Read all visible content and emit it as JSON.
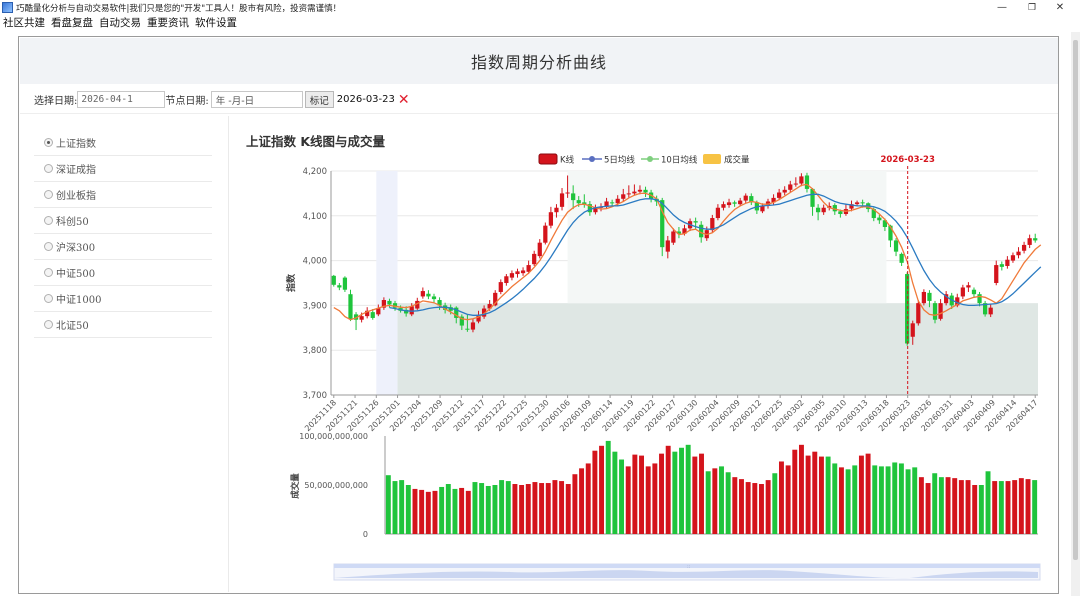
{
  "window": {
    "title": "巧酷量化分析与自动交易软件|我们只是您的\"开发\"工具人！股市有风险，投资需谨慎！",
    "controls": [
      "—",
      "❐",
      "✕"
    ]
  },
  "menu": [
    "社区共建",
    "看盘复盘",
    "自动交易",
    "重要资讯",
    "软件设置"
  ],
  "page_title": "指数周期分析曲线",
  "toolbar": {
    "select_date_label": "选择日期:",
    "select_date_value": "2026-04-1",
    "node_date_label": "节点日期:",
    "node_date_placeholder": "年 -月-日",
    "mark_button": "标记",
    "marked_date": "2026-03-23",
    "close_icon": "✕"
  },
  "sidebar": {
    "items": [
      {
        "label": "上证指数",
        "selected": true
      },
      {
        "label": "深证成指",
        "selected": false
      },
      {
        "label": "创业板指",
        "selected": false
      },
      {
        "label": "科创50",
        "selected": false
      },
      {
        "label": "沪深300",
        "selected": false
      },
      {
        "label": "中证500",
        "selected": false
      },
      {
        "label": "中证1000",
        "selected": false
      },
      {
        "label": "北证50",
        "selected": false
      }
    ]
  },
  "chart_data": {
    "type": "candlestick",
    "title": "上证指数 K线图与成交量",
    "legend": [
      "K线",
      "5日均线",
      "10日均线",
      "成交量"
    ],
    "legend_position": "top-center",
    "colors": {
      "up": "#d4141c",
      "down": "#1fc43c",
      "ma5": "#f07a3a",
      "ma10": "#2b7bc2",
      "volume": "#f7c344",
      "area": "#dfe7e4",
      "band": "#eef1fb",
      "marker": "#d4141c"
    },
    "price_axis": {
      "label": "指数",
      "min": 3700,
      "max": 4200,
      "ticks": [
        "3,700",
        "3,800",
        "3,900",
        "4,000",
        "4,100",
        "4,200"
      ]
    },
    "volume_axis": {
      "label": "成交量",
      "min": 0,
      "max": 100000000000,
      "ticks": [
        "0",
        "50,000,000,000",
        "100,000,000,000"
      ]
    },
    "marker": {
      "date": "20260323",
      "label": "2026-03-23"
    },
    "shaded_periods": [
      {
        "start": "20251126",
        "end": "20251201",
        "level": 3800
      },
      {
        "start": "20251201",
        "end": "20260417",
        "level": 3905
      }
    ],
    "x_labels": [
      "20251118",
      "20251121",
      "20251126",
      "20251201",
      "20251204",
      "20251209",
      "20251212",
      "20251217",
      "20251222",
      "20251225",
      "20251230",
      "20260106",
      "20260109",
      "20260114",
      "20260119",
      "20260122",
      "20260127",
      "20260130",
      "20260204",
      "20260209",
      "20260212",
      "20260225",
      "20260302",
      "20260305",
      "20260310",
      "20260313",
      "20260318",
      "20260323",
      "20260326",
      "20260331",
      "20260403",
      "20260409",
      "20260414",
      "20260417"
    ],
    "candles": [
      [
        3966,
        3946,
        3968,
        3942
      ],
      [
        3945,
        3940,
        3950,
        3934
      ],
      [
        3962,
        3935,
        3965,
        3930
      ],
      [
        3925,
        3870,
        3935,
        3865
      ],
      [
        3880,
        3868,
        3885,
        3845
      ],
      [
        3868,
        3876,
        3884,
        3862
      ],
      [
        3876,
        3888,
        3896,
        3871
      ],
      [
        3885,
        3872,
        3892,
        3868
      ],
      [
        3880,
        3894,
        3902,
        3876
      ],
      [
        3895,
        3912,
        3918,
        3890
      ],
      [
        3910,
        3902,
        3915,
        3895
      ],
      [
        3905,
        3895,
        3910,
        3888
      ],
      [
        3894,
        3888,
        3900,
        3884
      ],
      [
        3890,
        3882,
        3898,
        3875
      ],
      [
        3880,
        3898,
        3905,
        3876
      ],
      [
        3893,
        3910,
        3917,
        3890
      ],
      [
        3920,
        3932,
        3940,
        3915
      ],
      [
        3926,
        3920,
        3934,
        3914
      ],
      [
        3920,
        3914,
        3926,
        3905
      ],
      [
        3912,
        3900,
        3918,
        3890
      ],
      [
        3900,
        3890,
        3906,
        3882
      ],
      [
        3896,
        3888,
        3902,
        3880
      ],
      [
        3895,
        3872,
        3898,
        3860
      ],
      [
        3875,
        3855,
        3880,
        3845
      ],
      [
        3848,
        3846,
        3880,
        3841
      ],
      [
        3846,
        3862,
        3870,
        3840
      ],
      [
        3864,
        3879,
        3888,
        3860
      ],
      [
        3875,
        3893,
        3900,
        3870
      ],
      [
        3893,
        3903,
        3912,
        3888
      ],
      [
        3900,
        3928,
        3934,
        3898
      ],
      [
        3930,
        3952,
        3958,
        3925
      ],
      [
        3950,
        3965,
        3970,
        3944
      ],
      [
        3962,
        3972,
        3978,
        3956
      ],
      [
        3970,
        3976,
        3982,
        3962
      ],
      [
        3972,
        3978,
        3985,
        3966
      ],
      [
        3975,
        3990,
        4000,
        3970
      ],
      [
        3992,
        4015,
        4022,
        3988
      ],
      [
        4010,
        4040,
        4048,
        4005
      ],
      [
        4040,
        4078,
        4085,
        4036
      ],
      [
        4078,
        4108,
        4120,
        4072
      ],
      [
        4108,
        4118,
        4126,
        4096
      ],
      [
        4120,
        4150,
        4162,
        4112
      ],
      [
        4150,
        4152,
        4190,
        4140
      ],
      [
        4150,
        4135,
        4168,
        4115
      ],
      [
        4135,
        4128,
        4144,
        4120
      ],
      [
        4130,
        4126,
        4148,
        4118
      ],
      [
        4126,
        4108,
        4133,
        4100
      ],
      [
        4108,
        4118,
        4125,
        4103
      ],
      [
        4118,
        4120,
        4128,
        4110
      ],
      [
        4120,
        4132,
        4140,
        4116
      ],
      [
        4130,
        4128,
        4136,
        4120
      ],
      [
        4128,
        4138,
        4146,
        4122
      ],
      [
        4138,
        4148,
        4160,
        4132
      ],
      [
        4148,
        4150,
        4168,
        4140
      ],
      [
        4150,
        4154,
        4170,
        4145
      ],
      [
        4154,
        4158,
        4168,
        4148
      ],
      [
        4158,
        4152,
        4165,
        4142
      ],
      [
        4152,
        4138,
        4158,
        4130
      ],
      [
        4138,
        4132,
        4145,
        4122
      ],
      [
        4135,
        4030,
        4140,
        4010
      ],
      [
        4020,
        4045,
        4055,
        4005
      ],
      [
        4040,
        4065,
        4072,
        4035
      ],
      [
        4065,
        4060,
        4075,
        4050
      ],
      [
        4060,
        4072,
        4080,
        4056
      ],
      [
        4072,
        4088,
        4094,
        4066
      ],
      [
        4088,
        4085,
        4096,
        4070
      ],
      [
        4080,
        4052,
        4088,
        4040
      ],
      [
        4050,
        4068,
        4076,
        4044
      ],
      [
        4068,
        4095,
        4102,
        4062
      ],
      [
        4095,
        4118,
        4126,
        4090
      ],
      [
        4118,
        4126,
        4132,
        4112
      ],
      [
        4124,
        4130,
        4138,
        4118
      ],
      [
        4130,
        4127,
        4134,
        4120
      ],
      [
        4126,
        4134,
        4140,
        4122
      ],
      [
        4134,
        4145,
        4150,
        4128
      ],
      [
        4144,
        4130,
        4150,
        4124
      ],
      [
        4130,
        4112,
        4134,
        4104
      ],
      [
        4110,
        4122,
        4128,
        4106
      ],
      [
        4122,
        4132,
        4138,
        4116
      ],
      [
        4130,
        4140,
        4148,
        4125
      ],
      [
        4140,
        4152,
        4160,
        4135
      ],
      [
        4152,
        4158,
        4166,
        4146
      ],
      [
        4158,
        4170,
        4178,
        4152
      ],
      [
        4170,
        4172,
        4186,
        4165
      ],
      [
        4172,
        4188,
        4195,
        4166
      ],
      [
        4190,
        4160,
        4196,
        4152
      ],
      [
        4160,
        4120,
        4162,
        4100
      ],
      [
        4118,
        4108,
        4126,
        4090
      ],
      [
        4108,
        4118,
        4125,
        4102
      ],
      [
        4118,
        4122,
        4130,
        4112
      ],
      [
        4124,
        4110,
        4128,
        4102
      ],
      [
        4110,
        4104,
        4114,
        4096
      ],
      [
        4104,
        4115,
        4126,
        4100
      ],
      [
        4116,
        4126,
        4134,
        4110
      ],
      [
        4126,
        4130,
        4134,
        4122
      ],
      [
        4130,
        4128,
        4136,
        4118
      ],
      [
        4128,
        4115,
        4130,
        4108
      ],
      [
        4115,
        4095,
        4118,
        4088
      ],
      [
        4096,
        4090,
        4102,
        4082
      ],
      [
        4090,
        4075,
        4094,
        4066
      ],
      [
        4078,
        4045,
        4080,
        4030
      ],
      [
        4045,
        4020,
        4050,
        4010
      ],
      [
        4015,
        3995,
        4018,
        3988
      ],
      [
        3970,
        3815,
        3974,
        3810
      ],
      [
        3830,
        3860,
        3866,
        3812
      ],
      [
        3860,
        3905,
        3912,
        3855
      ],
      [
        3905,
        3930,
        3936,
        3900
      ],
      [
        3928,
        3910,
        3934,
        3896
      ],
      [
        3905,
        3868,
        3910,
        3860
      ],
      [
        3870,
        3905,
        3914,
        3866
      ],
      [
        3905,
        3925,
        3932,
        3900
      ],
      [
        3922,
        3900,
        3928,
        3892
      ],
      [
        3900,
        3918,
        3926,
        3896
      ],
      [
        3920,
        3940,
        3946,
        3914
      ],
      [
        3940,
        3945,
        3952,
        3930
      ],
      [
        3935,
        3925,
        3940,
        3918
      ],
      [
        3925,
        3905,
        3930,
        3898
      ],
      [
        3905,
        3880,
        3910,
        3875
      ],
      [
        3880,
        3895,
        3902,
        3874
      ],
      [
        3950,
        3990,
        4000,
        3945
      ],
      [
        3992,
        3986,
        3998,
        3978
      ],
      [
        3988,
        4002,
        4010,
        3982
      ],
      [
        4000,
        4012,
        4018,
        3995
      ],
      [
        4012,
        4020,
        4030,
        4005
      ],
      [
        4022,
        4035,
        4042,
        4016
      ],
      [
        4035,
        4050,
        4058,
        4028
      ],
      [
        4050,
        4045,
        4060,
        4040
      ]
    ],
    "ma5": [
      3895,
      3888,
      3875,
      3868,
      3872,
      3880,
      3886,
      3890,
      3894,
      3898,
      3900,
      3898,
      3896,
      3895,
      3898,
      3904,
      3910,
      3908,
      3906,
      3900,
      3892,
      3885,
      3878,
      3870,
      3868,
      3870,
      3874,
      3882,
      3892,
      3905,
      3918,
      3930,
      3942,
      3952,
      3962,
      3972,
      3985,
      4000,
      4020,
      4045,
      4068,
      4090,
      4108,
      4118,
      4125,
      4126,
      4122,
      4118,
      4115,
      4116,
      4120,
      4126,
      4132,
      4140,
      4146,
      4150,
      4150,
      4146,
      4138,
      4110,
      4085,
      4070,
      4058,
      4060,
      4068,
      4070,
      4062,
      4058,
      4062,
      4072,
      4088,
      4102,
      4114,
      4122,
      4128,
      4132,
      4130,
      4126,
      4126,
      4130,
      4136,
      4144,
      4152,
      4160,
      4168,
      4170,
      4160,
      4145,
      4130,
      4118,
      4115,
      4112,
      4110,
      4112,
      4116,
      4120,
      4120,
      4114,
      4104,
      4092,
      4075,
      4055,
      4030,
      3998,
      3950,
      3910,
      3890,
      3880,
      3878,
      3882,
      3888,
      3895,
      3902,
      3910,
      3914,
      3918,
      3920,
      3918,
      3912,
      3905,
      3915,
      3935,
      3955,
      3975,
      3995,
      4010,
      4025,
      4035
    ],
    "ma10": [
      null,
      null,
      null,
      null,
      null,
      null,
      null,
      null,
      null,
      null,
      3895,
      3893,
      3890,
      3888,
      3887,
      3888,
      3890,
      3893,
      3895,
      3896,
      3896,
      3894,
      3890,
      3885,
      3880,
      3878,
      3878,
      3880,
      3884,
      3890,
      3898,
      3906,
      3915,
      3925,
      3936,
      3948,
      3960,
      3974,
      3990,
      4008,
      4028,
      4048,
      4068,
      4085,
      4098,
      4108,
      4114,
      4118,
      4120,
      4121,
      4122,
      4122,
      4124,
      4128,
      4132,
      4136,
      4138,
      4138,
      4136,
      4128,
      4115,
      4102,
      4092,
      4085,
      4080,
      4076,
      4072,
      4070,
      4070,
      4074,
      4080,
      4088,
      4096,
      4104,
      4110,
      4116,
      4120,
      4122,
      4123,
      4124,
      4126,
      4130,
      4134,
      4138,
      4142,
      4146,
      4148,
      4148,
      4144,
      4138,
      4132,
      4128,
      4126,
      4124,
      4122,
      4122,
      4122,
      4120,
      4116,
      4110,
      4100,
      4088,
      4072,
      4052,
      4028,
      4002,
      3978,
      3958,
      3942,
      3930,
      3920,
      3912,
      3906,
      3902,
      3900,
      3900,
      3901,
      3902,
      3903,
      3904,
      3908,
      3916,
      3926,
      3938,
      3950,
      3962,
      3974,
      3986
    ],
    "volumes": [
      60,
      54,
      55,
      50,
      46,
      45,
      43,
      44,
      48,
      51,
      46,
      47,
      44,
      53,
      52,
      49,
      50,
      55,
      54,
      51,
      50,
      51,
      53,
      52,
      52,
      55,
      54,
      51,
      61,
      67,
      72,
      85,
      90,
      95,
      84,
      76,
      69,
      81,
      80,
      69,
      72,
      82,
      90,
      84,
      88,
      91,
      79,
      82,
      64,
      67,
      69,
      63,
      58,
      56,
      53,
      52,
      51,
      55,
      62,
      74,
      70,
      86,
      91,
      80,
      84,
      79,
      79,
      72,
      68,
      66,
      70,
      80,
      82,
      70,
      69,
      69,
      73,
      72,
      66,
      68,
      58,
      52,
      62,
      58,
      58,
      57,
      55,
      55,
      50,
      50,
      64,
      54,
      54,
      54,
      55,
      57,
      56,
      55
    ]
  }
}
